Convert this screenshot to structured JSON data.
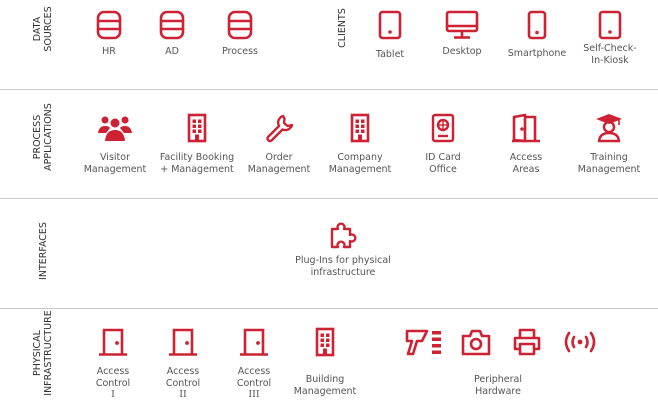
{
  "colors": {
    "accent": "#cc2233",
    "text": "#555555",
    "divider": "#c9c9c9"
  },
  "sections": {
    "data_sources": {
      "line1": "DATA",
      "line2": "SOURCES"
    },
    "clients": {
      "label": "CLIENTS"
    },
    "process_applications": {
      "line1": "PROCESS",
      "line2": "APPLICATIONS"
    },
    "interfaces": {
      "label": "INTERFACES"
    },
    "physical_infrastructure": {
      "line1": "PHYSICAL",
      "line2": "INFRASTRUCTURE"
    }
  },
  "data_sources": [
    {
      "label": "HR",
      "icon": "database-icon"
    },
    {
      "label": "AD",
      "icon": "database-icon"
    },
    {
      "label": "Process",
      "icon": "database-icon"
    }
  ],
  "clients": [
    {
      "line1": "Tablet",
      "line2": "",
      "icon": "tablet-icon"
    },
    {
      "line1": "Desktop",
      "line2": "",
      "icon": "desktop-icon"
    },
    {
      "line1": "Smartphone",
      "line2": "",
      "icon": "smartphone-icon"
    },
    {
      "line1": "Self-Check-",
      "line2": "In-Kiosk",
      "icon": "kiosk-icon"
    }
  ],
  "process_applications": [
    {
      "line1": "Visitor",
      "line2": "Management",
      "icon": "people-icon"
    },
    {
      "line1": "Facility Booking",
      "line2": "+ Management",
      "icon": "building-icon"
    },
    {
      "line1": "Order",
      "line2": "Management",
      "icon": "wrench-icon"
    },
    {
      "line1": "Company",
      "line2": "Management",
      "icon": "building-icon"
    },
    {
      "line1": "ID Card",
      "line2": "Office",
      "icon": "id-card-icon"
    },
    {
      "line1": "Access",
      "line2": "Areas",
      "icon": "door-open-icon"
    },
    {
      "line1": "Training",
      "line2": "Management",
      "icon": "graduate-icon"
    }
  ],
  "interfaces": {
    "line1": "Plug-Ins for physical",
    "line2": "infrastructure",
    "icon": "puzzle-icon"
  },
  "physical_infrastructure": {
    "access_controls": [
      {
        "line1": "Access",
        "line2": "Control",
        "line3": "I",
        "icon": "door-icon"
      },
      {
        "line1": "Access",
        "line2": "Control",
        "line3": "II",
        "icon": "door-icon"
      },
      {
        "line1": "Access",
        "line2": "Control",
        "line3": "III",
        "icon": "door-icon"
      }
    ],
    "building": {
      "line1": "Building",
      "line2": "Management",
      "icon": "building-icon"
    },
    "peripheral": {
      "line1": "Peripheral",
      "line2": "Hardware",
      "icons": [
        "scanner-icon",
        "camera-icon",
        "printer-icon",
        "wireless-icon"
      ]
    }
  }
}
